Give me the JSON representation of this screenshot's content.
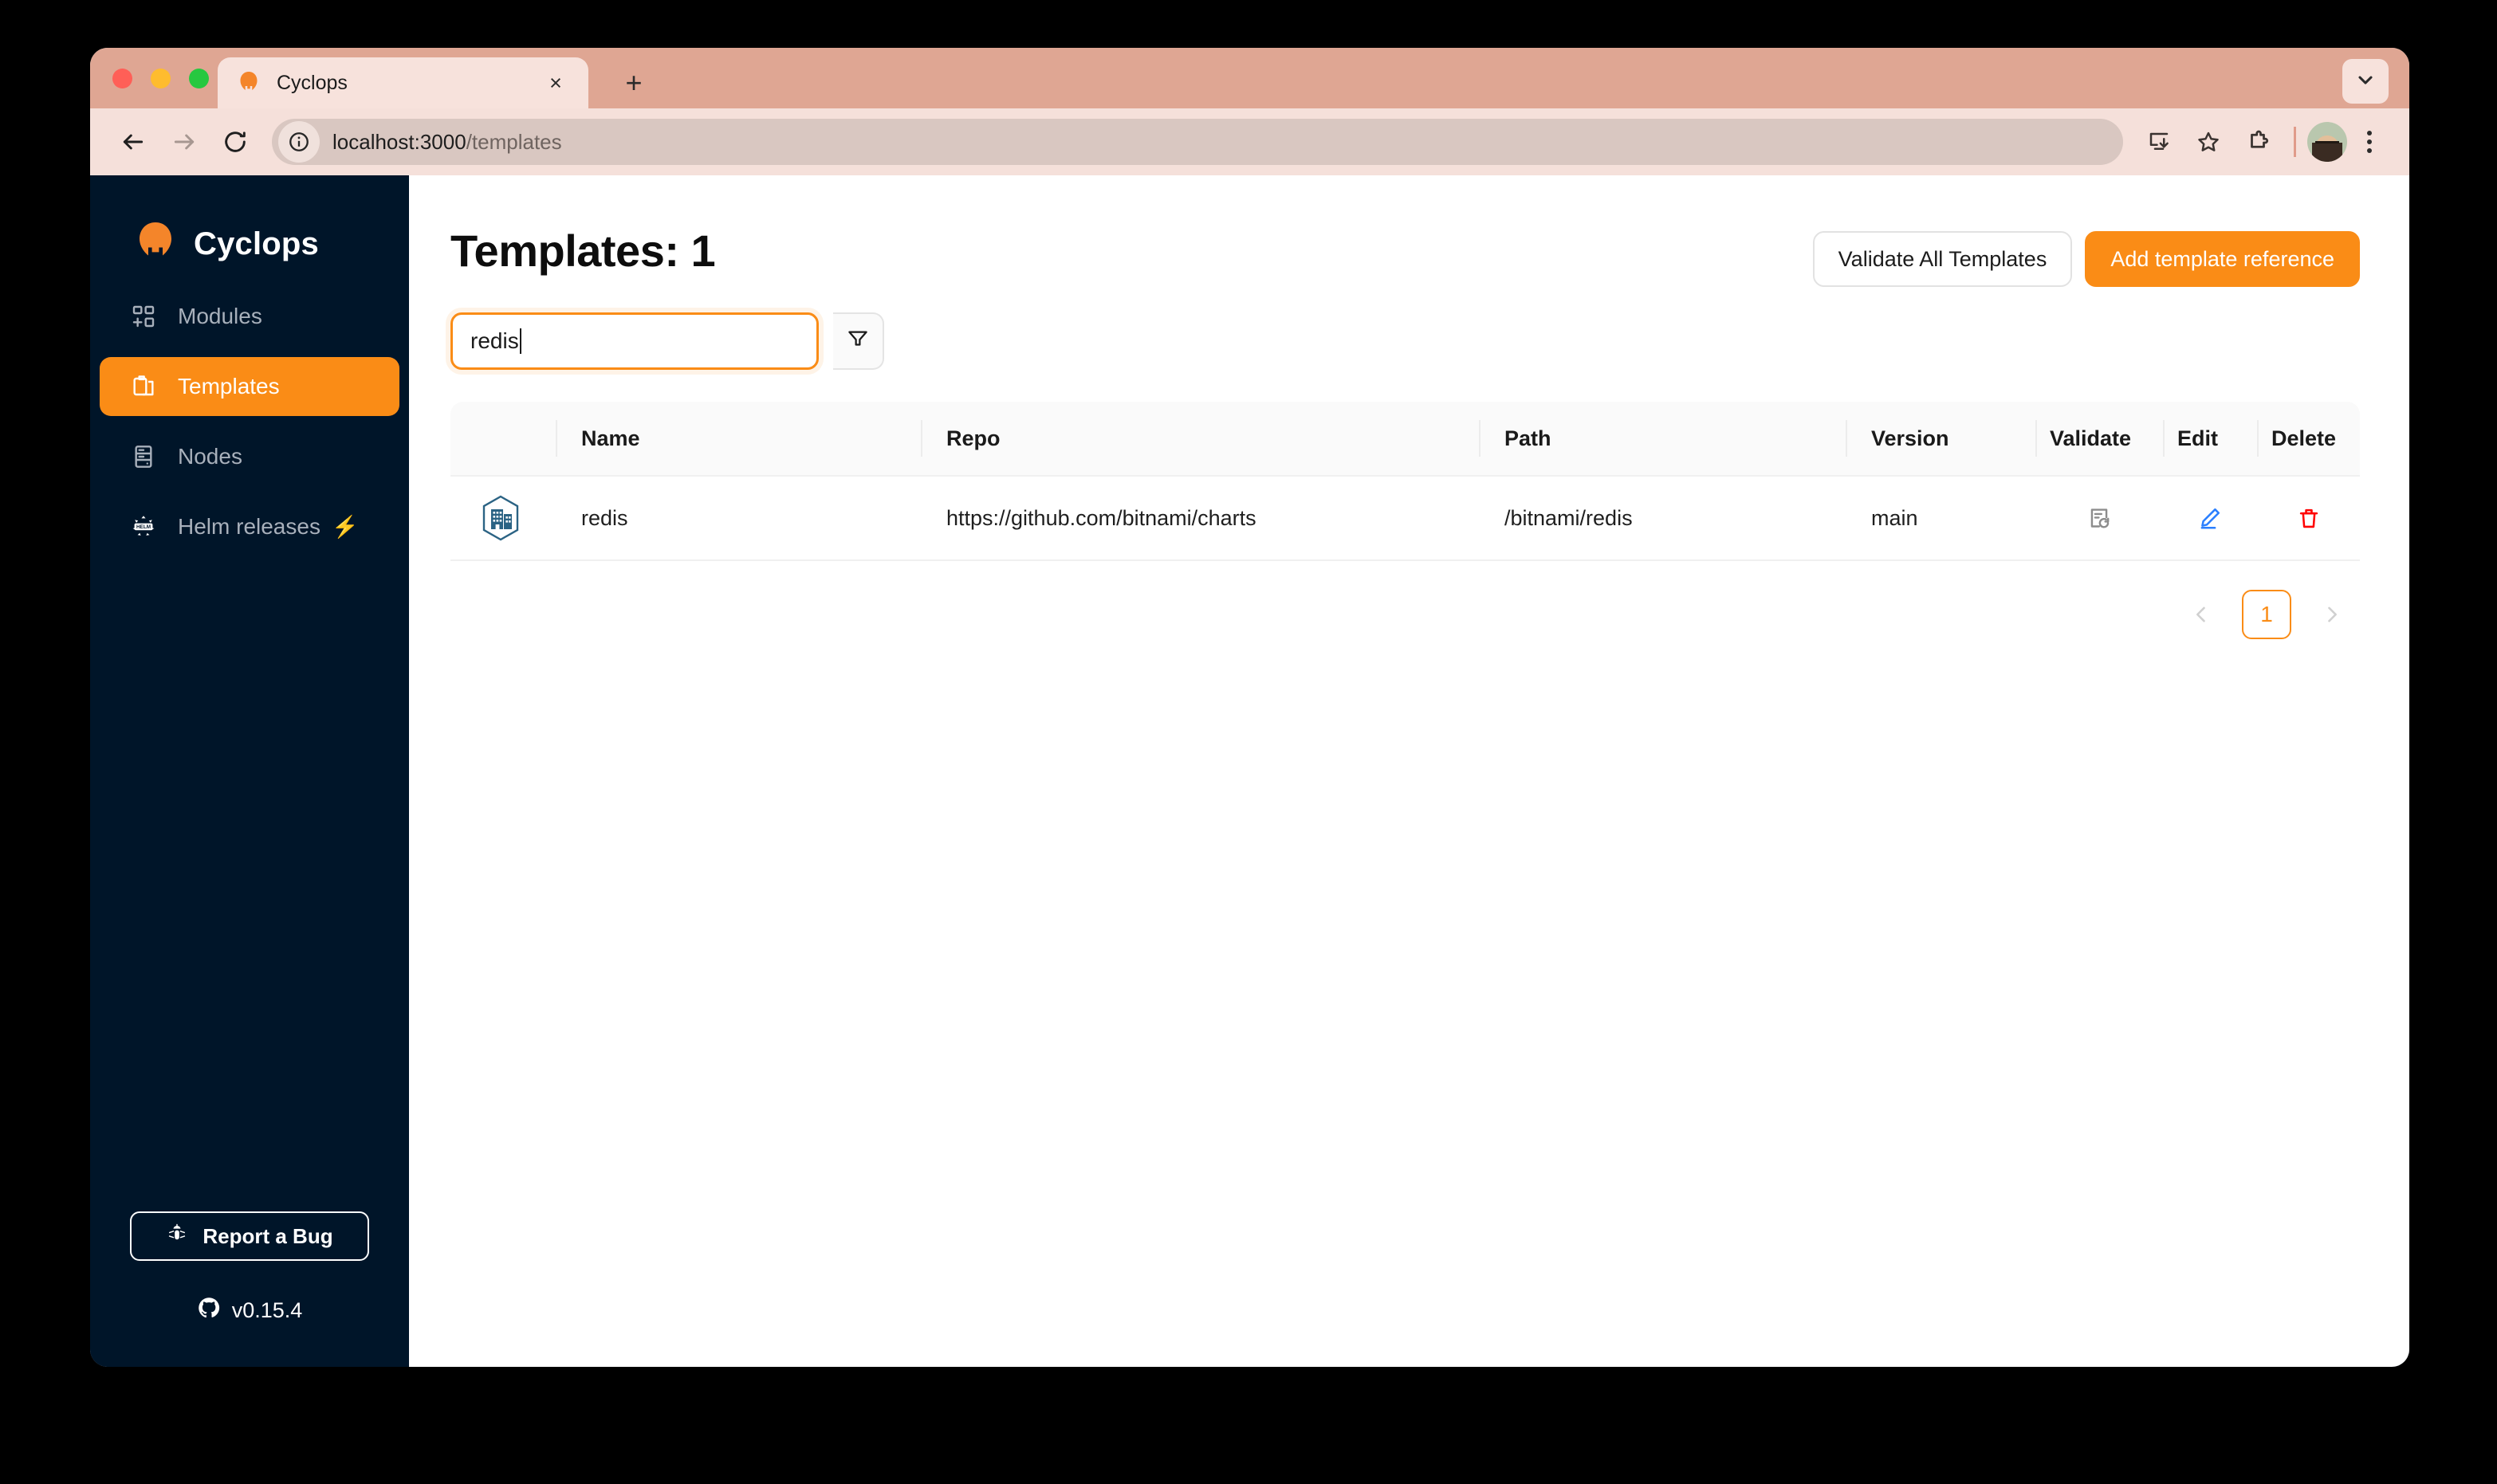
{
  "browser": {
    "tab": {
      "title": "Cyclops",
      "favicon": "cyclops-logo-icon",
      "close": "×"
    },
    "new_tab_label": "+",
    "url_host": "localhost:3000",
    "url_path": "/templates",
    "toolbar_icons": [
      "back-arrow-icon",
      "forward-arrow-icon",
      "reload-icon",
      "site-info-icon",
      "install-app-icon",
      "bookmark-star-icon",
      "extensions-icon",
      "profile-avatar",
      "chrome-menu-icon"
    ],
    "tab_list_icon": "chevron-down-icon"
  },
  "sidebar": {
    "brand": "Cyclops",
    "items": [
      {
        "label": "Modules",
        "icon": "modules-icon",
        "active": false
      },
      {
        "label": "Templates",
        "icon": "templates-icon",
        "active": true
      },
      {
        "label": "Nodes",
        "icon": "nodes-icon",
        "active": false
      },
      {
        "label": "Helm releases",
        "icon": "helm-icon",
        "badge": "⚡",
        "active": false
      }
    ],
    "report_bug": "Report a Bug",
    "version": "v0.15.4"
  },
  "main": {
    "title": "Templates: 1",
    "validate_all_label": "Validate All Templates",
    "add_template_label": "Add template reference",
    "search": {
      "value": "redis",
      "placeholder": ""
    },
    "filter_icon": "funnel-filter-icon",
    "table": {
      "columns": [
        "",
        "Name",
        "Repo",
        "Path",
        "Version",
        "Validate",
        "Edit",
        "Delete"
      ],
      "rows": [
        {
          "icon": "repo-building-hex-icon",
          "name": "redis",
          "repo": "https://github.com/bitnami/charts",
          "path": "/bitnami/redis",
          "version": "main",
          "validate_icon": "file-sync-icon",
          "edit_icon": "pencil-edit-icon",
          "delete_icon": "trash-delete-icon"
        }
      ]
    },
    "pagination": {
      "prev": "‹",
      "page": "1",
      "next": "›"
    }
  },
  "colors": {
    "accent": "#fa8c16",
    "sidebar_bg": "#001529",
    "browser_tabstrip": "#dfa693",
    "browser_toolbar": "#f5e0da",
    "repo_icon": "#2b6384",
    "edit_icon": "#2a7fff",
    "delete_icon": "#ff0000"
  }
}
